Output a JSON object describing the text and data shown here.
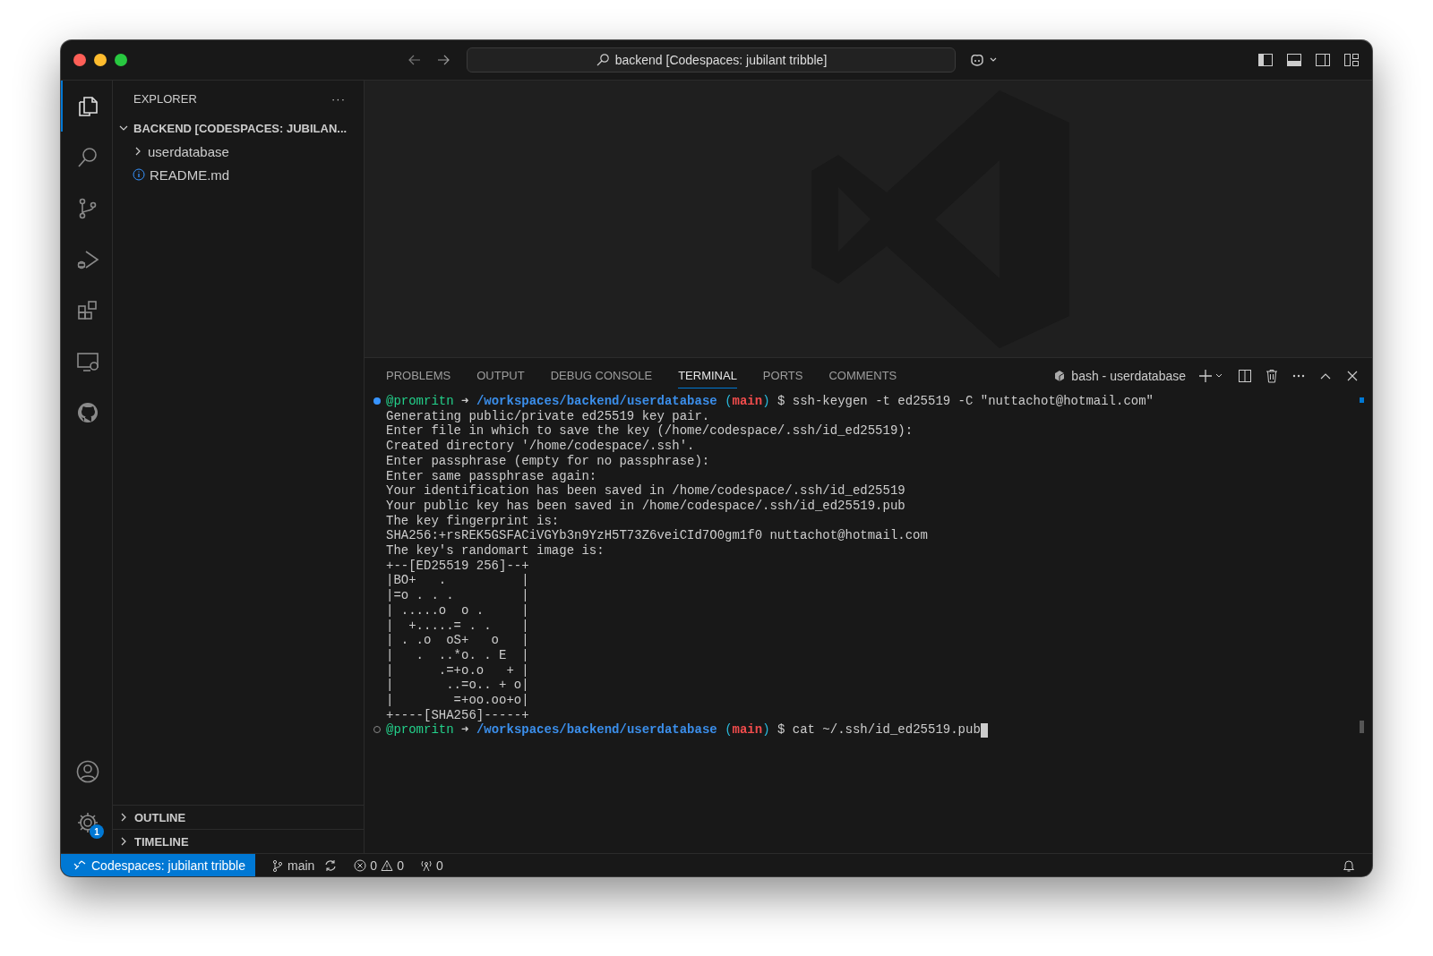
{
  "title_bar": {
    "search": "backend [Codespaces: jubilant tribble]"
  },
  "activity_bar": {
    "items": [
      {
        "kind": "explorer",
        "selected": true
      },
      {
        "kind": "search",
        "selected": false
      },
      {
        "kind": "source-control",
        "selected": false
      },
      {
        "kind": "run",
        "selected": false
      },
      {
        "kind": "extensions",
        "selected": false
      },
      {
        "kind": "remote",
        "selected": false
      },
      {
        "kind": "github",
        "selected": false
      }
    ],
    "bottom": [
      {
        "kind": "account"
      },
      {
        "kind": "settings",
        "badge": "1"
      }
    ]
  },
  "sidebar": {
    "title": "EXPLORER",
    "more": "···",
    "folder": {
      "label": "BACKEND [CODESPACES: JUBILAN...",
      "expanded": true,
      "children": [
        {
          "label": "userdatabase",
          "kind": "folder",
          "expanded": false
        },
        {
          "label": "README.md",
          "kind": "info"
        }
      ]
    },
    "sections": [
      {
        "label": "OUTLINE",
        "expanded": false
      },
      {
        "label": "TIMELINE",
        "expanded": false
      }
    ]
  },
  "panel": {
    "tabs": [
      {
        "label": "PROBLEMS",
        "selected": false
      },
      {
        "label": "OUTPUT",
        "selected": false
      },
      {
        "label": "DEBUG CONSOLE",
        "selected": false
      },
      {
        "label": "TERMINAL",
        "selected": true
      },
      {
        "label": "PORTS",
        "selected": false
      },
      {
        "label": "COMMENTS",
        "selected": false
      }
    ],
    "terminal_name": "bash - userdatabase",
    "lines": [
      {
        "kind": "prompt",
        "succeeded": true,
        "user": "@promritn",
        "arrow": "➜",
        "path": "/workspaces/backend/userdatabase",
        "branch_open": "(",
        "branch": "main",
        "branch_close": ")",
        "command": "$ ssh-keygen -t ed25519 -C \"nuttachot@hotmail.com\"",
        "cursor": false
      },
      {
        "kind": "output",
        "text": "Generating public/private ed25519 key pair."
      },
      {
        "kind": "output",
        "text": "Enter file in which to save the key (/home/codespace/.ssh/id_ed25519):"
      },
      {
        "kind": "output",
        "text": "Created directory '/home/codespace/.ssh'."
      },
      {
        "kind": "output",
        "text": "Enter passphrase (empty for no passphrase):"
      },
      {
        "kind": "output",
        "text": "Enter same passphrase again:"
      },
      {
        "kind": "output",
        "text": "Your identification has been saved in /home/codespace/.ssh/id_ed25519"
      },
      {
        "kind": "output",
        "text": "Your public key has been saved in /home/codespace/.ssh/id_ed25519.pub"
      },
      {
        "kind": "output",
        "text": "The key fingerprint is:"
      },
      {
        "kind": "output",
        "text": "SHA256:+rsREK5GSFACiVGYb3n9YzH5T73Z6veiCId7O0gm1f0 nuttachot@hotmail.com"
      },
      {
        "kind": "output",
        "text": "The key's randomart image is:"
      },
      {
        "kind": "output",
        "text": "+--[ED25519 256]--+"
      },
      {
        "kind": "output",
        "text": "|BO+   .          |"
      },
      {
        "kind": "output",
        "text": "|=o . . .         |"
      },
      {
        "kind": "output",
        "text": "| .....o  o .     |"
      },
      {
        "kind": "output",
        "text": "|  +.....= . .    |"
      },
      {
        "kind": "output",
        "text": "| . .o  oS+   o   |"
      },
      {
        "kind": "output",
        "text": "|   .  ..*o. . E  |"
      },
      {
        "kind": "output",
        "text": "|      .=+o.o   + |"
      },
      {
        "kind": "output",
        "text": "|       ..=o.. + o|"
      },
      {
        "kind": "output",
        "text": "|        =+oo.oo+o|"
      },
      {
        "kind": "output",
        "text": "+----[SHA256]-----+"
      },
      {
        "kind": "prompt",
        "succeeded": false,
        "user": "@promritn",
        "arrow": "➜",
        "path": "/workspaces/backend/userdatabase",
        "branch_open": "(",
        "branch": "main",
        "branch_close": ")",
        "command": "$ cat ~/.ssh/id_ed25519.pub",
        "cursor": true
      }
    ]
  },
  "status_bar": {
    "remote": "Codespaces: jubilant tribble",
    "branch": "main",
    "errors": "0",
    "warnings": "0",
    "ports": "0"
  }
}
